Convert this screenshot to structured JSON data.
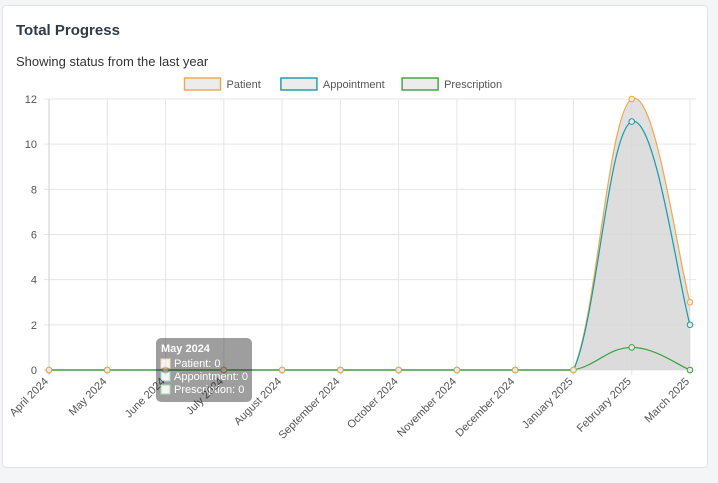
{
  "card": {
    "title": "Total Progress",
    "subtitle": "Showing status from the last year"
  },
  "colors": {
    "patient": "#f0a848",
    "appointment": "#1a9aa8",
    "prescription": "#3aa33a",
    "fill": "#d7d7d7"
  },
  "chart_data": {
    "type": "line",
    "title": "",
    "xlabel": "",
    "ylabel": "",
    "ylim": [
      0,
      12
    ],
    "yticks": [
      0,
      2,
      4,
      6,
      8,
      10,
      12
    ],
    "grid": true,
    "legend_position": "top-center",
    "categories": [
      "April 2024",
      "May 2024",
      "June 2024",
      "July 2024",
      "August 2024",
      "September 2024",
      "October 2024",
      "November 2024",
      "December 2024",
      "January 2025",
      "February 2025",
      "March 2025"
    ],
    "series": [
      {
        "name": "Patient",
        "color": "#f0a848",
        "values": [
          0,
          0,
          0,
          0,
          0,
          0,
          0,
          0,
          0,
          0,
          12,
          3
        ]
      },
      {
        "name": "Appointment",
        "color": "#1a9aa8",
        "values": [
          0,
          0,
          0,
          0,
          0,
          0,
          0,
          0,
          0,
          0,
          11,
          2
        ]
      },
      {
        "name": "Prescription",
        "color": "#3aa33a",
        "values": [
          0,
          0,
          0,
          0,
          0,
          0,
          0,
          0,
          0,
          0,
          1,
          0
        ]
      }
    ],
    "tooltip": {
      "title": "May 2024",
      "lines": [
        "Patient: 0",
        "Appointment: 0",
        "Prescription: 0"
      ]
    }
  }
}
